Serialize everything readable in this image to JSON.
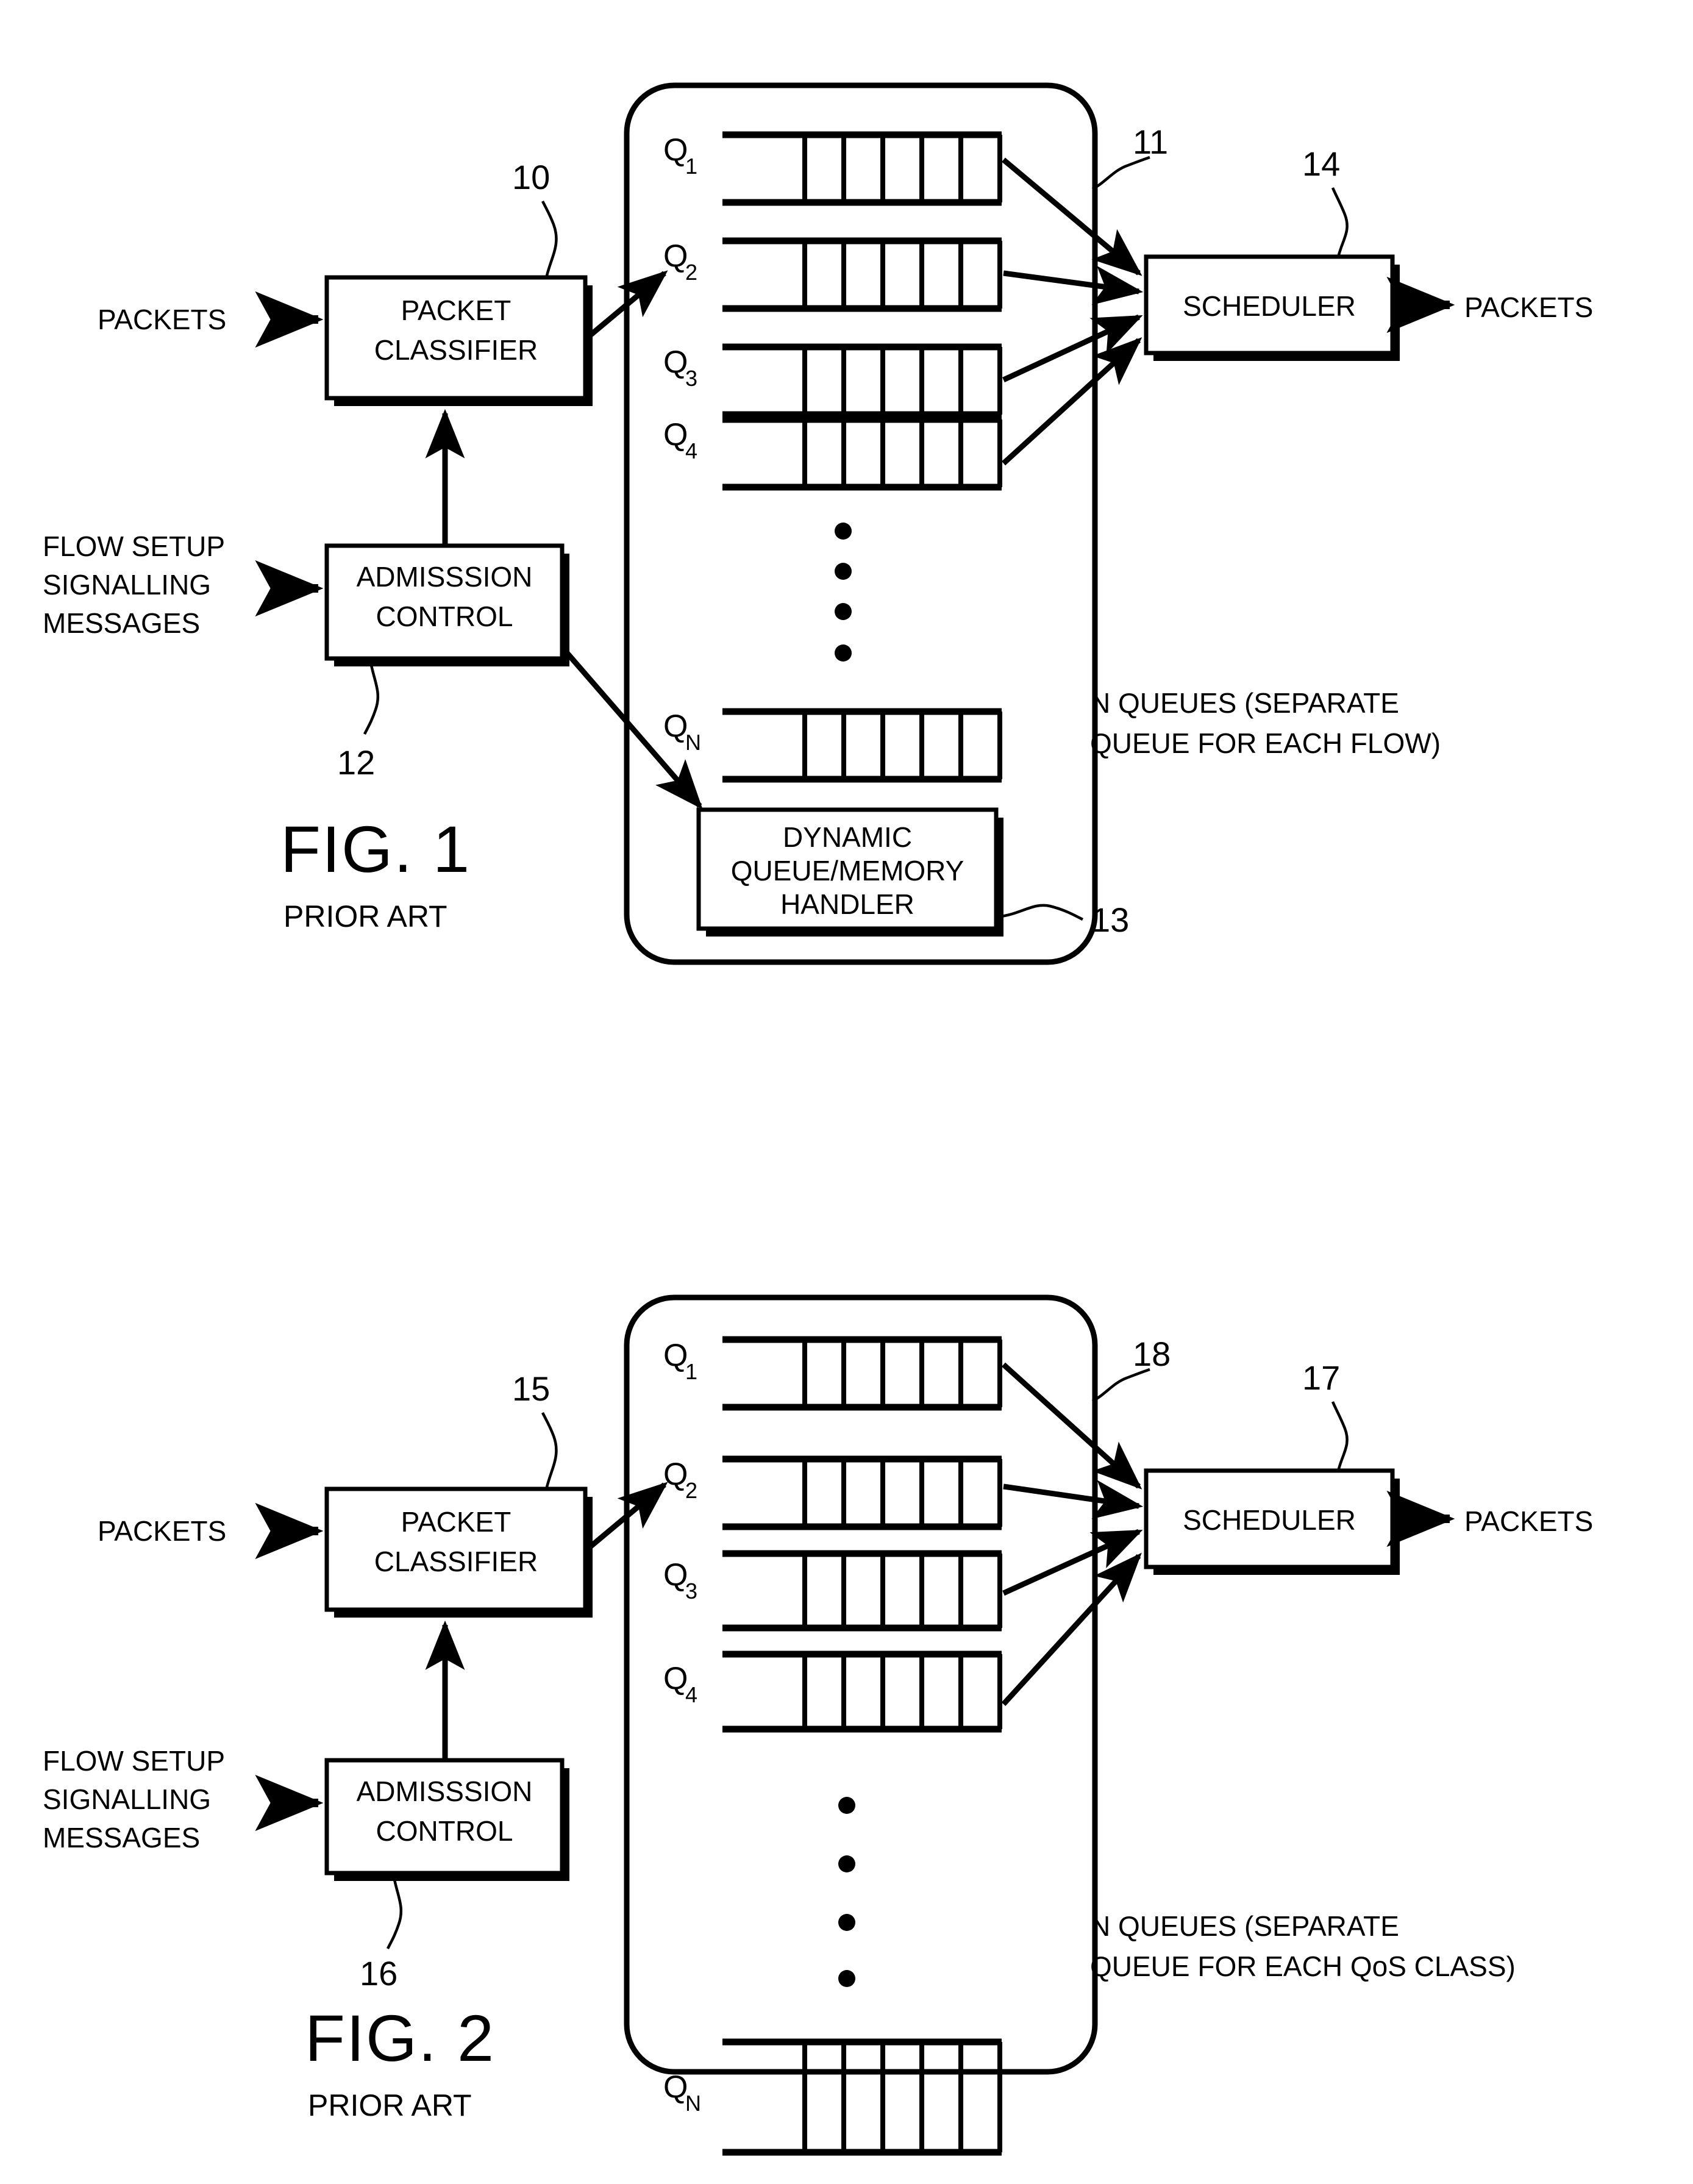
{
  "document": {
    "kind": "patent-drawing-sheet",
    "background_color": "#ffffff",
    "ink_color": "#000000"
  },
  "figures": [
    {
      "id": "figure-1",
      "caption": "FIG. 1",
      "subcaption": "PRIOR ART",
      "blocks": [
        {
          "key": "packet_classifier",
          "lines": [
            "PACKET",
            "CLASSIFIER"
          ],
          "ref": "10"
        },
        {
          "key": "admission_control",
          "lines": [
            "ADMISSSION",
            "CONTROL"
          ],
          "ref": "12"
        },
        {
          "key": "scheduler",
          "lines": [
            "SCHEDULER"
          ],
          "ref": "14"
        },
        {
          "key": "dynamic_queue_memory_handler",
          "lines": [
            "DYNAMIC",
            "QUEUE/MEMORY",
            "HANDLER"
          ],
          "ref": "13"
        }
      ],
      "container_ref": "11",
      "io_labels": {
        "input_packets": "PACKETS",
        "input_signalling": [
          "FLOW SETUP",
          "SIGNALLING",
          "MESSAGES"
        ],
        "output_packets": "PACKETS"
      },
      "queues": [
        {
          "name": "Q",
          "sub": "1",
          "cells": 5
        },
        {
          "name": "Q",
          "sub": "2",
          "cells": 5
        },
        {
          "name": "Q",
          "sub": "3",
          "cells": 5
        },
        {
          "name": "Q",
          "sub": "4",
          "cells": 5
        },
        {
          "name": "Q",
          "sub": "N",
          "cells": 5
        }
      ],
      "ellipsis_dots": 4,
      "annotation": [
        "N QUEUES (SEPARATE",
        "QUEUE FOR EACH FLOW)"
      ]
    },
    {
      "id": "figure-2",
      "caption": "FIG. 2",
      "subcaption": "PRIOR ART",
      "blocks": [
        {
          "key": "packet_classifier",
          "lines": [
            "PACKET",
            "CLASSIFIER"
          ],
          "ref": "15"
        },
        {
          "key": "admission_control",
          "lines": [
            "ADMISSSION",
            "CONTROL"
          ],
          "ref": "16"
        },
        {
          "key": "scheduler",
          "lines": [
            "SCHEDULER"
          ],
          "ref": "17"
        }
      ],
      "container_ref": "18",
      "io_labels": {
        "input_packets": "PACKETS",
        "input_signalling": [
          "FLOW SETUP",
          "SIGNALLING",
          "MESSAGES"
        ],
        "output_packets": "PACKETS"
      },
      "queues": [
        {
          "name": "Q",
          "sub": "1",
          "cells": 5
        },
        {
          "name": "Q",
          "sub": "2",
          "cells": 5
        },
        {
          "name": "Q",
          "sub": "3",
          "cells": 5
        },
        {
          "name": "Q",
          "sub": "4",
          "cells": 5
        },
        {
          "name": "Q",
          "sub": "N",
          "cells": 5
        }
      ],
      "ellipsis_dots": 4,
      "annotation": [
        "N QUEUES (SEPARATE",
        "QUEUE FOR EACH QoS CLASS)"
      ]
    }
  ],
  "fig1": {
    "caption": "FIG. 1",
    "subcaption": "PRIOR ART",
    "pc_l1": "PACKET",
    "pc_l2": "CLASSIFIER",
    "pc_ref": "10",
    "ac_l1": "ADMISSSION",
    "ac_l2": "CONTROL",
    "ac_ref": "12",
    "sch": "SCHEDULER",
    "sch_ref": "14",
    "dh_l1": "DYNAMIC",
    "dh_l2": "QUEUE/MEMORY",
    "dh_l3": "HANDLER",
    "dh_ref": "13",
    "cont_ref": "11",
    "in_packets": "PACKETS",
    "in_sig_l1": "FLOW SETUP",
    "in_sig_l2": "SIGNALLING",
    "in_sig_l3": "MESSAGES",
    "out_packets": "PACKETS",
    "ann_l1": "N QUEUES (SEPARATE",
    "ann_l2": "QUEUE FOR EACH FLOW)",
    "q1": "Q",
    "q1s": "1",
    "q2": "Q",
    "q2s": "2",
    "q3": "Q",
    "q3s": "3",
    "q4": "Q",
    "q4s": "4",
    "qn": "Q",
    "qns": "N"
  },
  "fig2": {
    "caption": "FIG. 2",
    "subcaption": "PRIOR ART",
    "pc_l1": "PACKET",
    "pc_l2": "CLASSIFIER",
    "pc_ref": "15",
    "ac_l1": "ADMISSSION",
    "ac_l2": "CONTROL",
    "ac_ref": "16",
    "sch": "SCHEDULER",
    "sch_ref": "17",
    "cont_ref": "18",
    "in_packets": "PACKETS",
    "in_sig_l1": "FLOW SETUP",
    "in_sig_l2": "SIGNALLING",
    "in_sig_l3": "MESSAGES",
    "out_packets": "PACKETS",
    "ann_l1": "N QUEUES (SEPARATE",
    "ann_l2": "QUEUE FOR EACH QoS CLASS)",
    "q1": "Q",
    "q1s": "1",
    "q2": "Q",
    "q2s": "2",
    "q3": "Q",
    "q3s": "3",
    "q4": "Q",
    "q4s": "4",
    "qn": "Q",
    "qns": "N"
  }
}
